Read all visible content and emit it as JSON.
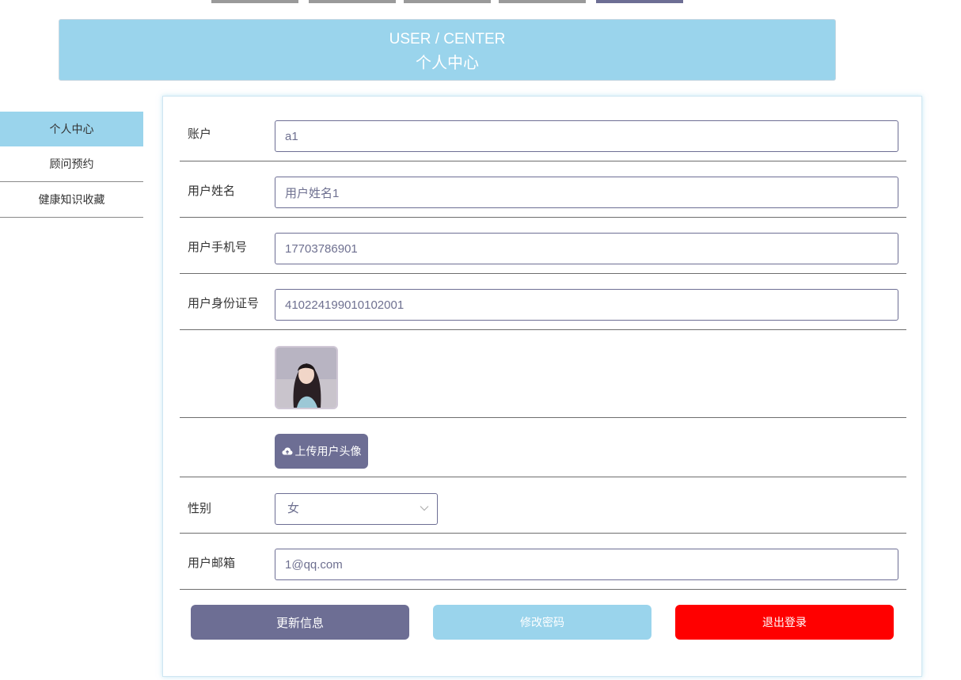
{
  "colors": {
    "primary": "#6d6e94",
    "accent": "#9ad4ec",
    "danger": "#ff0000",
    "top_tab_inactive": "#9a9a9a"
  },
  "header": {
    "title_en": "USER / CENTER",
    "title_cn": "个人中心"
  },
  "sidebar": {
    "items": [
      {
        "label": "个人中心",
        "active": true
      },
      {
        "label": "顾问预约",
        "active": false
      },
      {
        "label": "健康知识收藏",
        "active": false
      }
    ]
  },
  "form": {
    "account": {
      "label": "账户",
      "value": "a1"
    },
    "username": {
      "label": "用户姓名",
      "value": "用户姓名1"
    },
    "phone": {
      "label": "用户手机号",
      "value": "17703786901"
    },
    "id_number": {
      "label": "用户身份证号",
      "value": "410224199010102001"
    },
    "upload_avatar": {
      "label": "上传用户头像",
      "icon": "cloud-upload-icon"
    },
    "gender": {
      "label": "性别",
      "value": "女",
      "icon": "chevron-down-icon"
    },
    "email": {
      "label": "用户邮箱",
      "value": "1@qq.com"
    }
  },
  "actions": {
    "update": "更新信息",
    "change_password": "修改密码",
    "logout": "退出登录"
  }
}
